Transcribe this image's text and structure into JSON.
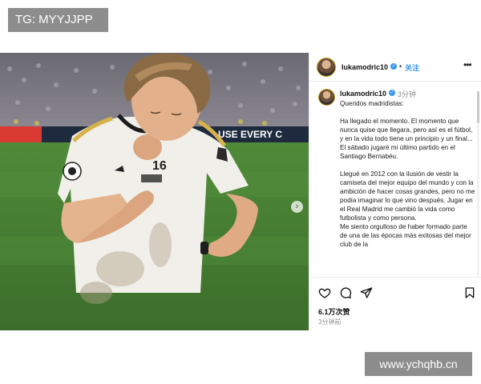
{
  "watermark_top": "TG: MYYJJPP",
  "watermark_bottom": "www.ychqhb.cn",
  "photo": {
    "alt_icon": "next-arrow-icon",
    "banner_text": "USE EVERY C",
    "jersey_number": "16"
  },
  "post": {
    "username": "lukamodric10",
    "follow_label": "关注",
    "more_label": "•••",
    "caption_username": "lukamodric10",
    "caption_time": "3分钟",
    "caption_paragraphs": [
      "Queridos madridistas:",
      "Ha llegado el momento. El momento que nunca quise que llegara, pero así es el fútbol, y en la vida todo tiene un principio y un final... El sábado jugaré mi último partido en el Santiago Bernabéu.",
      "Llegué en 2012 con la ilusión de vestir la camiseta del mejor equipo del mundo y con la ambición de hacer cosas grandes, pero no me podía imaginar lo que vino después. Jugar en el Real Madrid me cambió la vida como futbolista y como persona.",
      "Me siento orgulloso de haber formado parte de una de las épocas más exitosas del mejor club de la"
    ],
    "likes": "6.1万次赞",
    "posted_ago": "3分钟前",
    "icons": {
      "like": "heart-icon",
      "comment": "comment-icon",
      "share": "send-icon",
      "save": "bookmark-icon"
    }
  }
}
